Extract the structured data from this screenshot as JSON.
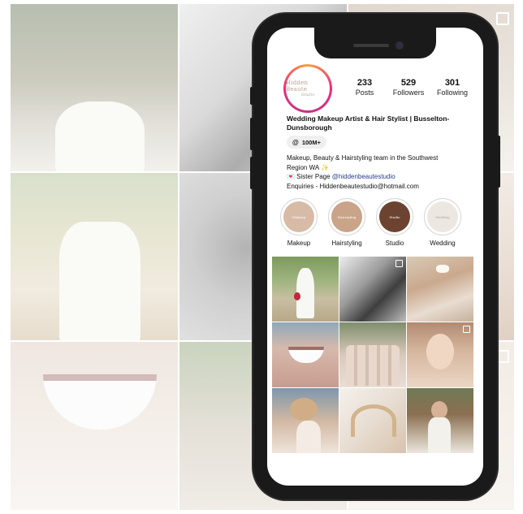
{
  "profile": {
    "avatar_brand": "Hidden Beaute",
    "avatar_brand_sub": "Studio",
    "stats": [
      {
        "value": "233",
        "label": "Posts"
      },
      {
        "value": "529",
        "label": "Followers"
      },
      {
        "value": "301",
        "label": "Following"
      }
    ],
    "name": "Wedding Makeup Artist & Hair Stylist | Busselton-Dunsborough",
    "threads_icon": "@",
    "threads_count": "100M+",
    "bio": {
      "line1": "Makeup, Beauty & Hairstyling team in the Southwest",
      "line2": "Region WA ✨",
      "line3_prefix": "💌 Sister Page ",
      "line3_link": "@hiddenbeautestudio",
      "line4": "Enquiries - Hiddenbeautestudio@hotmail.com"
    }
  },
  "highlights": [
    {
      "label": "Makeup",
      "inner_text": "Makeup",
      "color": "#d8bba6"
    },
    {
      "label": "Hairstyling",
      "inner_text": "Hairstyling",
      "color": "#c9a489"
    },
    {
      "label": "Studio",
      "inner_text": "Studio",
      "color": "#6b4330"
    },
    {
      "label": "Wedding",
      "inner_text": "Wedding",
      "color": "#ece7e1"
    }
  ]
}
